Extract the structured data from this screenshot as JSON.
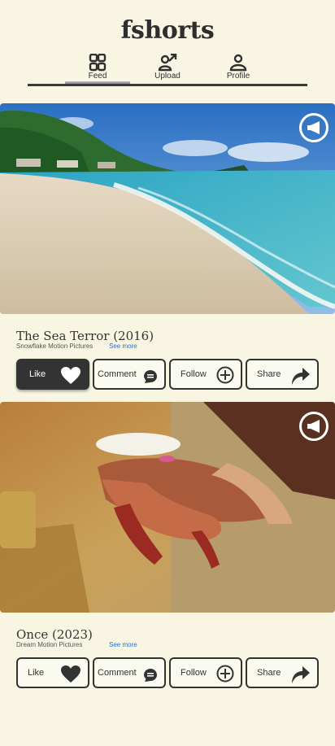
{
  "app": {
    "title": "fshorts"
  },
  "tabs": [
    {
      "label": "Feed",
      "icon": "grid-icon",
      "active": true
    },
    {
      "label": "Upload",
      "icon": "upload-user-icon",
      "active": false
    },
    {
      "label": "Profile",
      "icon": "profile-icon",
      "active": false
    }
  ],
  "posts": [
    {
      "title": "The Sea Terror (2016)",
      "studio": "Snowflake Motion Pictures",
      "see_more": "See more",
      "image": "beach-photo",
      "like_active": true
    },
    {
      "title": "Once (2023)",
      "studio": "Dream Motion Pictures",
      "see_more": "See more",
      "image": "henna-hands-photo",
      "like_active": false
    }
  ],
  "actions": {
    "like": "Like",
    "comment": "Comment",
    "follow": "Follow",
    "share": "Share"
  },
  "colors": {
    "background": "#f8f6e3",
    "ink": "#333333",
    "link": "#2d6fcb"
  }
}
